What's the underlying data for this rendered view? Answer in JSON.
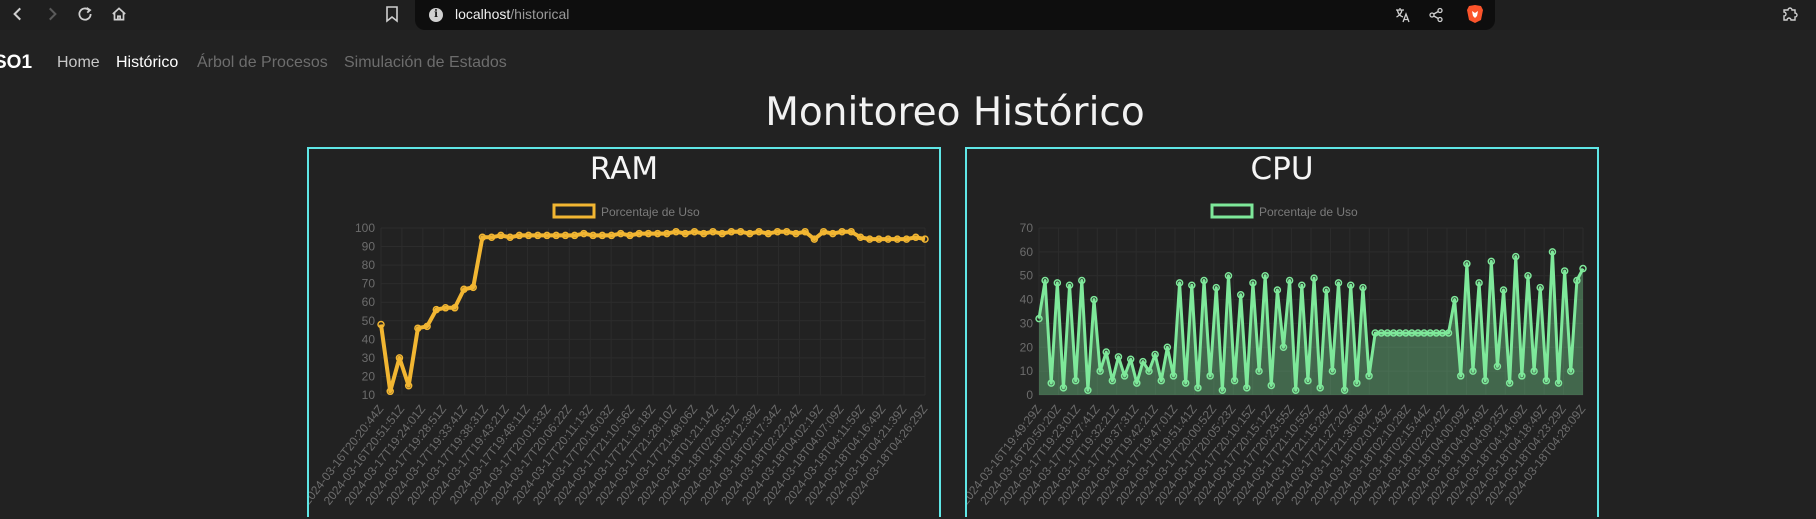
{
  "browser": {
    "url_host": "localhost",
    "url_path": "/historical"
  },
  "navbar": {
    "brand": "SO1",
    "links": [
      "Home",
      "Histórico",
      "Árbol de Procesos",
      "Simulación de Estados"
    ]
  },
  "page_title": "Monitoreo Histórico",
  "colors": {
    "ram": "#f2b632",
    "cpu": "#7ee89a",
    "panel_border": "#5fe6e6"
  },
  "chart_data": [
    {
      "type": "line",
      "title": "RAM",
      "legend": "Porcentaje de Uso",
      "ylim": [
        10,
        100
      ],
      "yticks": [
        100,
        90,
        80,
        70,
        60,
        50,
        40,
        30,
        20,
        10
      ],
      "xticks": [
        "2024-03-16T20:20:44Z",
        "2024-03-16T20:51:51Z",
        "2024-03-17T19:24:01Z",
        "2024-03-17T19:28:51Z",
        "2024-03-17T19:33:41Z",
        "2024-03-17T19:38:31Z",
        "2024-03-17T19:43:21Z",
        "2024-03-17T19:48:11Z",
        "2024-03-17T20:01:33Z",
        "2024-03-17T20:06:22Z",
        "2024-03-17T20:11:13Z",
        "2024-03-17T20:16:03Z",
        "2024-03-17T21:10:56Z",
        "2024-03-17T21:16:18Z",
        "2024-03-17T21:28:10Z",
        "2024-03-17T21:48:06Z",
        "2024-03-18T01:21:14Z",
        "2024-03-18T02:06:51Z",
        "2024-03-18T02:12:38Z",
        "2024-03-18T02:17:34Z",
        "2024-03-18T02:22:24Z",
        "2024-03-18T04:02:19Z",
        "2024-03-18T04:07:09Z",
        "2024-03-18T04:11:59Z",
        "2024-03-18T04:16:49Z",
        "2024-03-18T04:21:39Z",
        "2024-03-18T04:26:29Z"
      ],
      "values": [
        48,
        12,
        30,
        15,
        46,
        47,
        56,
        57,
        57,
        67,
        68,
        95,
        95,
        96,
        95,
        96,
        96,
        96,
        96,
        96,
        96,
        96,
        97,
        96,
        96,
        96,
        97,
        96,
        97,
        97,
        97,
        97,
        98,
        97,
        98,
        97,
        98,
        97,
        98,
        98,
        97,
        98,
        97,
        98,
        98,
        97,
        98,
        94,
        98,
        97,
        98,
        98,
        95,
        94,
        94,
        94,
        94,
        94,
        95,
        94
      ]
    },
    {
      "type": "line",
      "title": "CPU",
      "legend": "Porcentaje de Uso",
      "ylim": [
        0,
        70
      ],
      "yticks": [
        70,
        60,
        50,
        40,
        30,
        20,
        10,
        0
      ],
      "xticks": [
        "2024-03-16T19:49:29Z",
        "2024-03-16T20:50:20Z",
        "2024-03-17T19:23:01Z",
        "2024-03-17T19:27:41Z",
        "2024-03-17T19:32:21Z",
        "2024-03-17T19:37:31Z",
        "2024-03-17T19:42:21Z",
        "2024-03-17T19:47:01Z",
        "2024-03-17T19:51:41Z",
        "2024-03-17T20:00:52Z",
        "2024-03-17T20:05:23Z",
        "2024-03-17T20:10:15Z",
        "2024-03-17T20:15:12Z",
        "2024-03-17T20:23:55Z",
        "2024-03-17T21:10:55Z",
        "2024-03-17T21:15:28Z",
        "2024-03-17T21:27:20Z",
        "2024-03-17T21:36:08Z",
        "2024-03-18T02:01:43Z",
        "2024-03-18T02:10:28Z",
        "2024-03-18T02:15:44Z",
        "2024-03-18T02:20:42Z",
        "2024-03-18T04:00:09Z",
        "2024-03-18T04:04:49Z",
        "2024-03-18T04:09:25Z",
        "2024-03-18T04:14:09Z",
        "2024-03-18T04:18:49Z",
        "2024-03-18T04:23:29Z",
        "2024-03-18T04:28:09Z"
      ],
      "values": [
        32,
        48,
        5,
        47,
        3,
        46,
        6,
        48,
        2,
        40,
        10,
        18,
        6,
        16,
        8,
        15,
        5,
        14,
        10,
        17,
        6,
        20,
        8,
        47,
        5,
        46,
        3,
        48,
        8,
        45,
        2,
        50,
        6,
        42,
        3,
        47,
        10,
        50,
        4,
        44,
        20,
        48,
        2,
        46,
        6,
        49,
        3,
        44,
        10,
        47,
        2,
        46,
        5,
        45,
        8,
        26,
        26,
        26,
        26,
        26,
        26,
        26,
        26,
        26,
        26,
        26,
        26,
        26,
        40,
        8,
        55,
        10,
        47,
        6,
        56,
        12,
        44,
        5,
        58,
        8,
        50,
        10,
        45,
        6,
        60,
        5,
        52,
        10,
        48,
        53
      ]
    }
  ]
}
